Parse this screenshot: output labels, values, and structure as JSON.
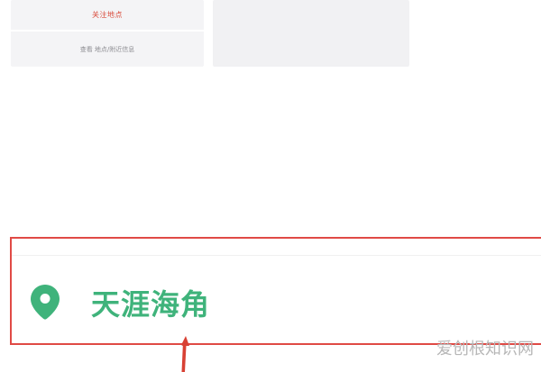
{
  "cards": {
    "left": {
      "top_label": "关注地点",
      "bottom_label": "查看 地点/附近信息"
    }
  },
  "location": {
    "name": "天涯海角"
  },
  "watermark": "爱创根知识网",
  "colors": {
    "highlight": "#e04a45",
    "location_text": "#3fb37b",
    "pin": "#3fb37b"
  }
}
